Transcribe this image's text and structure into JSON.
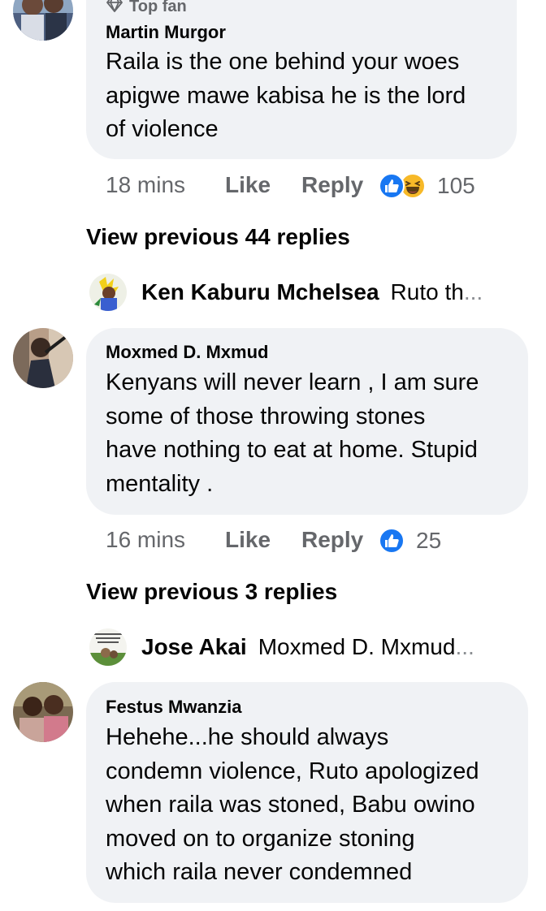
{
  "colors": {
    "bubble": "#f0f2f5",
    "meta_text": "#65676b",
    "like_blue": "#1877f2",
    "haha_yellow": "#f7b928"
  },
  "comments": [
    {
      "badge": "Top fan",
      "badge_icon": "diamond-icon",
      "author": "Martin Murgor",
      "lines": [
        "Raila is the one behind your woes",
        "apigwe mawe kabisa he is the lord",
        "of violence"
      ],
      "time": "18 mins",
      "like_label": "Like",
      "reply_label": "Reply",
      "reactions": [
        "like-reaction-icon",
        "haha-reaction-icon"
      ],
      "reaction_count": "105",
      "view_previous": "View previous 44 replies",
      "reply_preview": {
        "name": "Ken Kaburu Mchelsea",
        "text": "Ruto th",
        "ellipsis": "..."
      }
    },
    {
      "author": "Moxmed D. Mxmud",
      "lines": [
        "Kenyans will never learn , I am sure",
        "some of  those throwing stones",
        "have nothing to eat at home. Stupid",
        "mentality ."
      ],
      "time": "16 mins",
      "like_label": "Like",
      "reply_label": "Reply",
      "reactions": [
        "like-reaction-icon"
      ],
      "reaction_count": "25",
      "view_previous": "View previous 3 replies",
      "reply_preview": {
        "name": "Jose Akai",
        "text": "Moxmed D. Mxmud",
        "ellipsis": "..."
      }
    },
    {
      "author": "Festus Mwanzia",
      "lines": [
        "Hehehe...he should always",
        "condemn violence, Ruto apologized",
        "when raila was stoned, Babu owino",
        "moved on to organize stoning",
        "which raila never condemned"
      ]
    }
  ]
}
